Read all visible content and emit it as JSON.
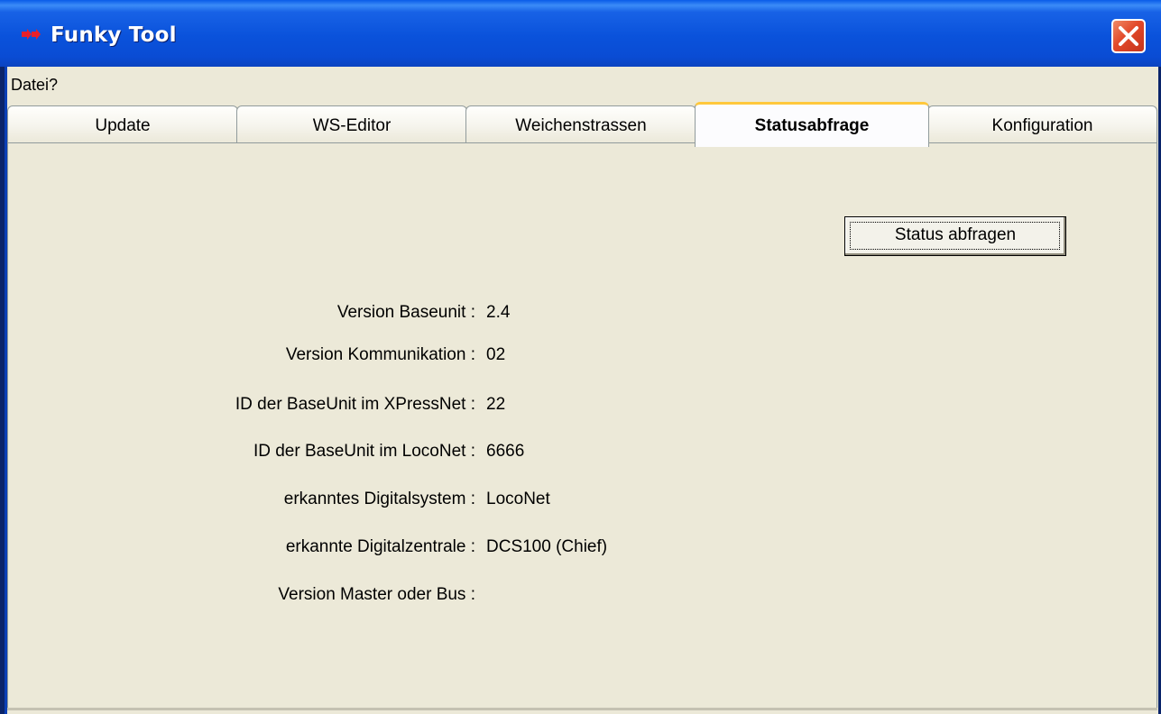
{
  "window": {
    "title": "Funky Tool"
  },
  "menu": {
    "items": [
      "Datei",
      "?"
    ]
  },
  "tabs": [
    {
      "label": "Update",
      "active": false
    },
    {
      "label": "WS-Editor",
      "active": false
    },
    {
      "label": "Weichenstrassen",
      "active": false
    },
    {
      "label": "Statusabfrage",
      "active": true
    },
    {
      "label": "Konfiguration",
      "active": false
    }
  ],
  "status": {
    "button_label": "Status abfragen",
    "rows": [
      {
        "label": "Version Baseunit :",
        "value": "2.4"
      },
      {
        "label": "Version Kommunikation :",
        "value": "02"
      },
      {
        "label": "ID der BaseUnit im XPressNet :",
        "value": "22"
      },
      {
        "label": "ID der BaseUnit im LocoNet :",
        "value": "6666"
      },
      {
        "label": "erkanntes Digitalsystem :",
        "value": "LocoNet"
      },
      {
        "label": "erkannte Digitalzentrale :",
        "value": "DCS100 (Chief)"
      },
      {
        "label": "Version Master oder Bus :",
        "value": ""
      }
    ]
  },
  "colors": {
    "titlebar": "#0a52db",
    "close_button": "#e2492a",
    "active_tab_accent": "#ffc83c",
    "panel_background": "#ECE9D8"
  },
  "icons": {
    "app": "red-arrows-icon",
    "close": "close-icon"
  }
}
